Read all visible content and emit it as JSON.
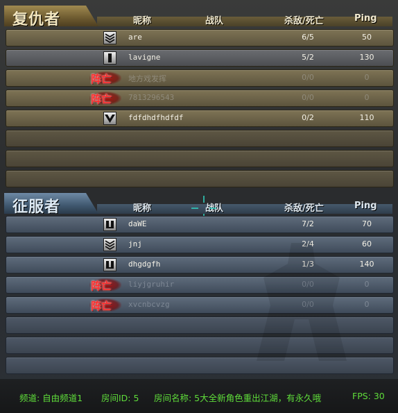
{
  "columns": {
    "nickname": "昵称",
    "squad": "战队",
    "kd": "杀敌/死亡",
    "ping": "Ping"
  },
  "dead_label": "阵亡",
  "teams": [
    {
      "name": "复仇者",
      "players": [
        {
          "name": "are",
          "kd": "6/5",
          "ping": "50",
          "status": "alive",
          "rank_icon": "chevron-rank-icon"
        },
        {
          "name": "lavigne",
          "kd": "5/2",
          "ping": "130",
          "status": "alive",
          "rank_icon": "bar-rank-icon"
        },
        {
          "name": "地方戏发挥",
          "kd": "0/0",
          "ping": "0",
          "status": "dead"
        },
        {
          "name": "7813296543",
          "kd": "0/0",
          "ping": "0",
          "status": "dead"
        },
        {
          "name": "fdfdhdfhdfdf",
          "kd": "0/2",
          "ping": "110",
          "status": "alive",
          "rank_icon": "v-rank-icon"
        }
      ]
    },
    {
      "name": "征服者",
      "players": [
        {
          "name": "daWE",
          "kd": "7/2",
          "ping": "70",
          "status": "alive",
          "rank_icon": "shield-rank-icon"
        },
        {
          "name": "jnj",
          "kd": "2/4",
          "ping": "60",
          "status": "alive",
          "rank_icon": "chevron-rank-icon"
        },
        {
          "name": "dhgdgfh",
          "kd": "1/3",
          "ping": "140",
          "status": "alive",
          "rank_icon": "shield-rank-icon"
        },
        {
          "name": "liyjgruhir",
          "kd": "0/0",
          "ping": "0",
          "status": "dead"
        },
        {
          "name": "xvcnbcvzg",
          "kd": "0/0",
          "ping": "0",
          "status": "dead"
        }
      ]
    }
  ],
  "footer": {
    "channel": "频道: 自由频道1",
    "room_id": "房间ID: 5",
    "room_name": "房间名称: 5大全新角色重出江湖，有永久哦",
    "fps": "FPS: 30"
  },
  "colors": {
    "footer_text": "#5fdd3a",
    "dead_badge": "#ff2b2b",
    "avenger_accent": "#a08a50",
    "conqueror_accent": "#6e8aa6"
  }
}
